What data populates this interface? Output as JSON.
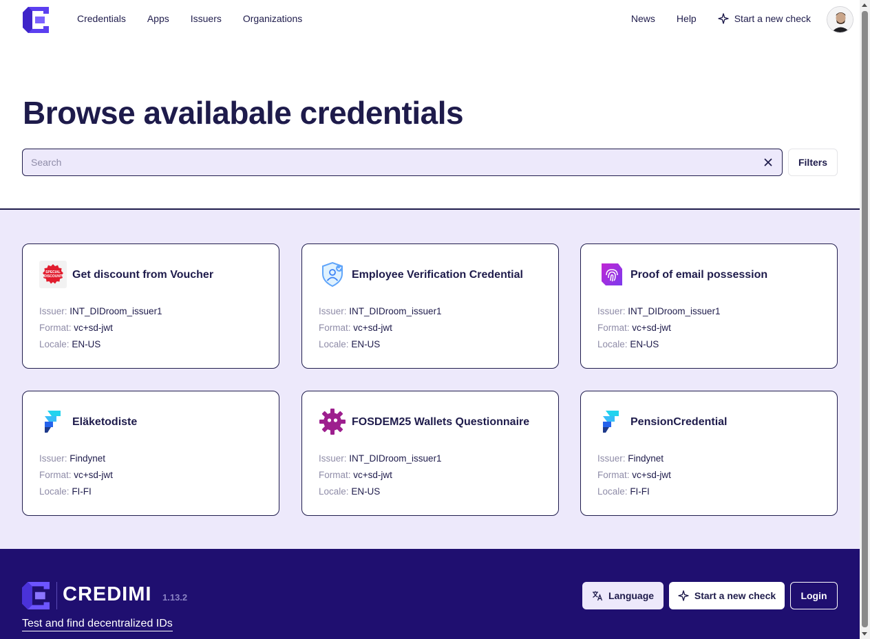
{
  "nav": {
    "links": [
      "Credentials",
      "Apps",
      "Issuers",
      "Organizations"
    ],
    "news": "News",
    "help": "Help",
    "new_check": "Start a new check"
  },
  "hero": {
    "title": "Browse availabale credentials",
    "search_placeholder": "Search",
    "search_value": "",
    "filters_label": "Filters"
  },
  "labels": {
    "issuer": "Issuer:",
    "format": "Format:",
    "locale": "Locale:"
  },
  "cards": [
    {
      "title": "Get discount from Voucher",
      "icon": "voucher-icon",
      "issuer": "INT_DIDroom_issuer1",
      "format": "vc+sd-jwt",
      "locale": "EN-US"
    },
    {
      "title": "Employee Verification Credential",
      "icon": "employee-shield-icon",
      "issuer": "INT_DIDroom_issuer1",
      "format": "vc+sd-jwt",
      "locale": "EN-US"
    },
    {
      "title": "Proof of email possession",
      "icon": "fingerprint-icon",
      "issuer": "INT_DIDroom_issuer1",
      "format": "vc+sd-jwt",
      "locale": "EN-US"
    },
    {
      "title": "Eläketodiste",
      "icon": "findynet-icon",
      "issuer": "Findynet",
      "format": "vc+sd-jwt",
      "locale": "FI-FI"
    },
    {
      "title": "FOSDEM25 Wallets Questionnaire",
      "icon": "fosdem-gear-icon",
      "issuer": "INT_DIDroom_issuer1",
      "format": "vc+sd-jwt",
      "locale": "EN-US"
    },
    {
      "title": "PensionCredential",
      "icon": "findynet-icon",
      "issuer": "Findynet",
      "format": "vc+sd-jwt",
      "locale": "FI-FI"
    }
  ],
  "footer": {
    "brand": "CREDIMI",
    "version": "1.13.2",
    "tagline": "Test and find decentralized IDs",
    "language": "Language",
    "new_check": "Start a new check",
    "login": "Login"
  },
  "colors": {
    "primary": "#1e1b4b",
    "accent_bg": "#ede9fb",
    "footer_bg": "#1f0f70",
    "logo": "#5b3ff0"
  }
}
